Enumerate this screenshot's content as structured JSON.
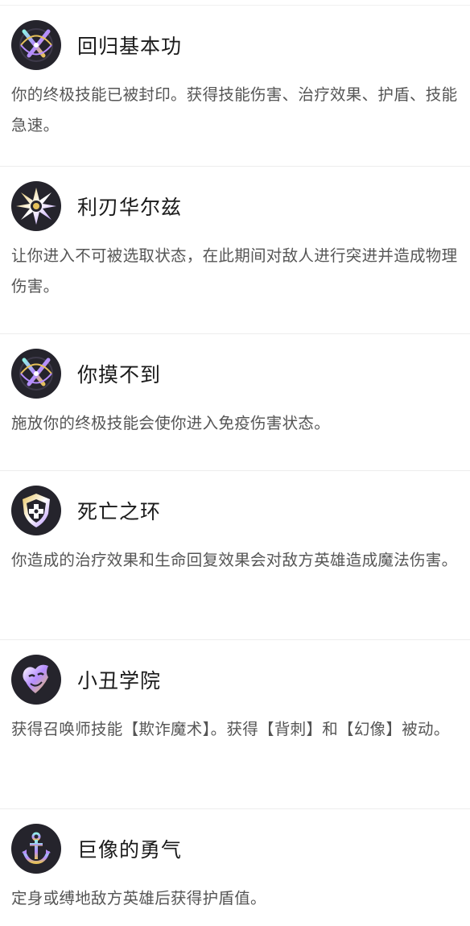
{
  "augments": [
    {
      "title": "回归基本功",
      "description": "你的终极技能已被封印。获得技能伤害、治疗效果、护盾、技能急速。",
      "icon": "crossed-swords-icon"
    },
    {
      "title": "利刃华尔兹",
      "description": "让你进入不可被选取状态，在此期间对敌人进行突进并造成物理伤害。",
      "icon": "blade-burst-icon"
    },
    {
      "title": "你摸不到",
      "description": "施放你的终极技能会使你进入免疫伤害状态。",
      "icon": "crossed-swords-icon"
    },
    {
      "title": "死亡之环",
      "description": "你造成的治疗效果和生命回复效果会对敌方英雄造成魔法伤害。",
      "icon": "shield-cross-icon"
    },
    {
      "title": "小丑学院",
      "description": "获得召唤师技能【欺诈魔术】。获得【背刺】和【幻像】被动。",
      "icon": "jester-mask-icon"
    },
    {
      "title": "巨像的勇气",
      "description": "定身或缚地敌方英雄后获得护盾值。",
      "icon": "anchor-icon"
    }
  ],
  "colors": {
    "icon_bg": "#25242c",
    "accent_purple": "#b58cff",
    "accent_gold": "#e6c15a",
    "accent_teal": "#8ff0e6"
  }
}
